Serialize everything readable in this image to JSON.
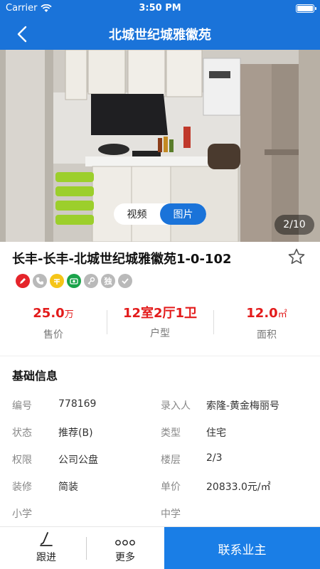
{
  "status_bar": {
    "carrier": "Carrier",
    "time": "3:50 PM"
  },
  "nav": {
    "title": "北城世纪城雅徽苑",
    "back_icon": "chevron-left-icon"
  },
  "media": {
    "tabs": [
      {
        "label": "视频",
        "active": false
      },
      {
        "label": "图片",
        "active": true
      }
    ],
    "counter": "2/10"
  },
  "listing": {
    "title": "长丰-长丰-北城世纪城雅徽苑1-0-102",
    "favorite_icon": "star-outline-icon",
    "tags": [
      {
        "icon": "pencil-icon",
        "color": "#e5242a"
      },
      {
        "icon": "phone-icon",
        "color": "#b9b9b9"
      },
      {
        "icon": "coin-icon",
        "color": "#f5c518"
      },
      {
        "icon": "camera-icon",
        "color": "#1aa34a"
      },
      {
        "icon": "key-icon",
        "color": "#b9b9b9"
      },
      {
        "icon": "exclusive-icon",
        "label": "独",
        "color": "#b9b9b9"
      },
      {
        "icon": "check-icon",
        "color": "#b9b9b9"
      }
    ]
  },
  "stats": [
    {
      "value": "25.0",
      "unit": "万",
      "label": "售价"
    },
    {
      "value": "12室2厅1卫",
      "unit": "",
      "label": "户型"
    },
    {
      "value": "12.0",
      "unit": "㎡",
      "label": "面积"
    }
  ],
  "basic_info": {
    "title": "基础信息",
    "rows": [
      {
        "k1": "编号",
        "v1": "778169",
        "k2": "录入人",
        "v2": "索隆-黄金梅丽号"
      },
      {
        "k1": "状态",
        "v1": "推荐(B)",
        "k2": "类型",
        "v2": "住宅"
      },
      {
        "k1": "权限",
        "v1": "公司公盘",
        "k2": "楼层",
        "v2": "2/3"
      },
      {
        "k1": "装修",
        "v1": "简装",
        "k2": "单价",
        "v2": "20833.0元/㎡"
      },
      {
        "k1": "小学",
        "v1": "",
        "k2": "中学",
        "v2": ""
      }
    ]
  },
  "bottom_bar": {
    "follow_label": "跟进",
    "more_label": "更多",
    "contact_label": "联系业主"
  },
  "colors": {
    "primary": "#1a73d9",
    "price_red": "#e31b1b"
  }
}
